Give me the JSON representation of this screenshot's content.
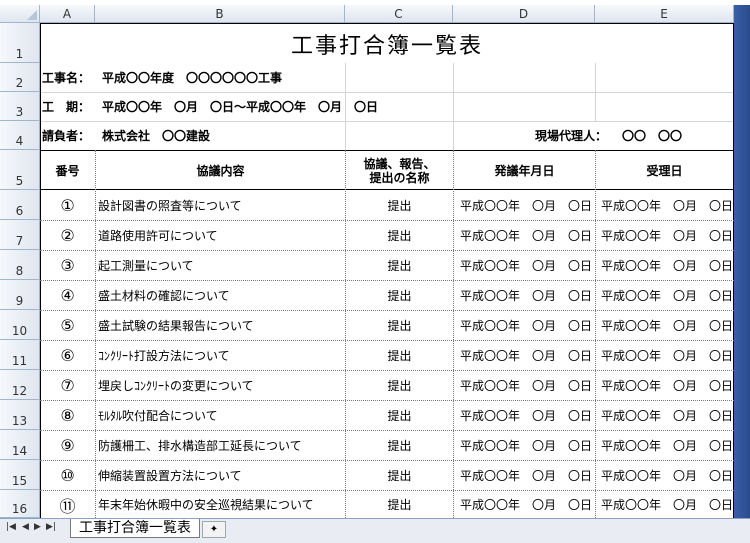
{
  "columns": [
    "A",
    "B",
    "C",
    "D",
    "E"
  ],
  "rows": [
    "1",
    "2",
    "3",
    "4",
    "5",
    "6",
    "7",
    "8",
    "9",
    "10",
    "11",
    "12",
    "13",
    "14",
    "15",
    "16"
  ],
  "title": "工事打合簿一覧表",
  "info": {
    "koji_label": "工事名：",
    "koji_value": "平成〇〇年度　〇〇〇〇〇〇工事",
    "kiki_label": "工　期：",
    "kiki_value": "平成〇〇年　〇月　〇日～平成〇〇年　〇月　〇日",
    "ukeoi_label": "請負者：",
    "ukeoi_value": "株式会社　〇〇建設",
    "dairi_label": "現場代理人：",
    "dairi_value": "〇〇　〇〇"
  },
  "table_headers": {
    "no": "番号",
    "content": "協議内容",
    "type_line1": "協議、報告、",
    "type_line2": "提出の名称",
    "proposed": "発議年月日",
    "received": "受理日"
  },
  "entries": [
    {
      "no": "①",
      "content": "設計図書の照査等について",
      "type": "提出",
      "proposed": "平成〇〇年　〇月　〇日",
      "received": "平成〇〇年　〇月　〇日"
    },
    {
      "no": "②",
      "content": "道路使用許可について",
      "type": "提出",
      "proposed": "平成〇〇年　〇月　〇日",
      "received": "平成〇〇年　〇月　〇日"
    },
    {
      "no": "③",
      "content": "起工測量について",
      "type": "提出",
      "proposed": "平成〇〇年　〇月　〇日",
      "received": "平成〇〇年　〇月　〇日"
    },
    {
      "no": "④",
      "content": "盛土材料の確認について",
      "type": "提出",
      "proposed": "平成〇〇年　〇月　〇日",
      "received": "平成〇〇年　〇月　〇日"
    },
    {
      "no": "⑤",
      "content": "盛土試験の結果報告について",
      "type": "提出",
      "proposed": "平成〇〇年　〇月　〇日",
      "received": "平成〇〇年　〇月　〇日"
    },
    {
      "no": "⑥",
      "content": "ｺﾝｸﾘｰﾄ打設方法について",
      "type": "提出",
      "proposed": "平成〇〇年　〇月　〇日",
      "received": "平成〇〇年　〇月　〇日"
    },
    {
      "no": "⑦",
      "content": "埋戻しｺﾝｸﾘｰﾄの変更について",
      "type": "提出",
      "proposed": "平成〇〇年　〇月　〇日",
      "received": "平成〇〇年　〇月　〇日"
    },
    {
      "no": "⑧",
      "content": "ﾓﾙﾀﾙ吹付配合について",
      "type": "提出",
      "proposed": "平成〇〇年　〇月　〇日",
      "received": "平成〇〇年　〇月　〇日"
    },
    {
      "no": "⑨",
      "content": "防護柵工、排水構造部工延長について",
      "type": "提出",
      "proposed": "平成〇〇年　〇月　〇日",
      "received": "平成〇〇年　〇月　〇日"
    },
    {
      "no": "⑩",
      "content": "伸縮装置設置方法について",
      "type": "提出",
      "proposed": "平成〇〇年　〇月　〇日",
      "received": "平成〇〇年　〇月　〇日"
    },
    {
      "no": "⑪",
      "content": "年末年始休暇中の安全巡視結果について",
      "type": "提出",
      "proposed": "平成〇〇年　〇月　〇日",
      "received": "平成〇〇年　〇月　〇日"
    }
  ],
  "sheet_tab": "工事打合簿一覧表",
  "colors": {
    "header_bg": "#dfe6ef",
    "grid_line": "#d4d4d4",
    "tab_bar": "#e9edf3",
    "right_edge": "#2a4b8c"
  }
}
